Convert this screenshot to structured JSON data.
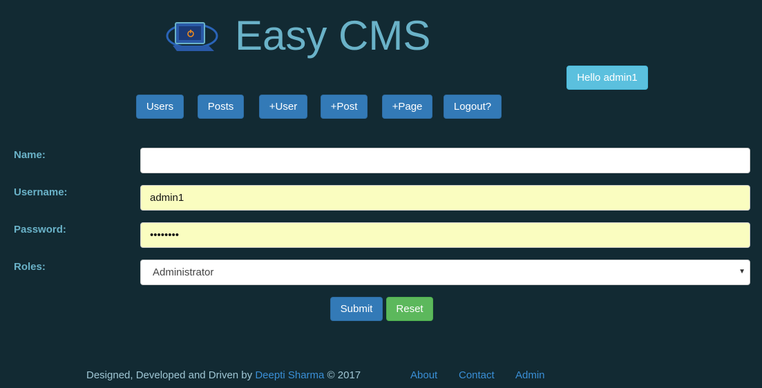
{
  "header": {
    "title": "Easy CMS",
    "logo_icon": "laptop-power-icon",
    "greeting": "Hello admin1"
  },
  "nav": {
    "items": [
      {
        "label": "Users"
      },
      {
        "label": "Posts"
      },
      {
        "label": "+User"
      },
      {
        "label": "+Post"
      },
      {
        "label": "+Page"
      },
      {
        "label": "Logout?"
      }
    ]
  },
  "form": {
    "name": {
      "label": "Name:",
      "value": ""
    },
    "username": {
      "label": "Username:",
      "value": "admin1"
    },
    "password": {
      "label": "Password:",
      "value": "••••••••"
    },
    "roles": {
      "label": "Roles:",
      "value": "Administrator"
    },
    "submit_label": "Submit",
    "reset_label": "Reset"
  },
  "footer": {
    "credit_prefix": "Designed, Developed and Driven by ",
    "author": "Deepti Sharma",
    "credit_suffix": " © 2017",
    "links": [
      {
        "label": "About"
      },
      {
        "label": "Contact"
      },
      {
        "label": "Admin"
      }
    ]
  },
  "colors": {
    "background": "#122a33",
    "accent_text": "#6ab2c8",
    "primary_button": "#337ab7",
    "info_button": "#5bc0de",
    "success_button": "#5cb85c",
    "autofill_bg": "#fafdc0"
  }
}
